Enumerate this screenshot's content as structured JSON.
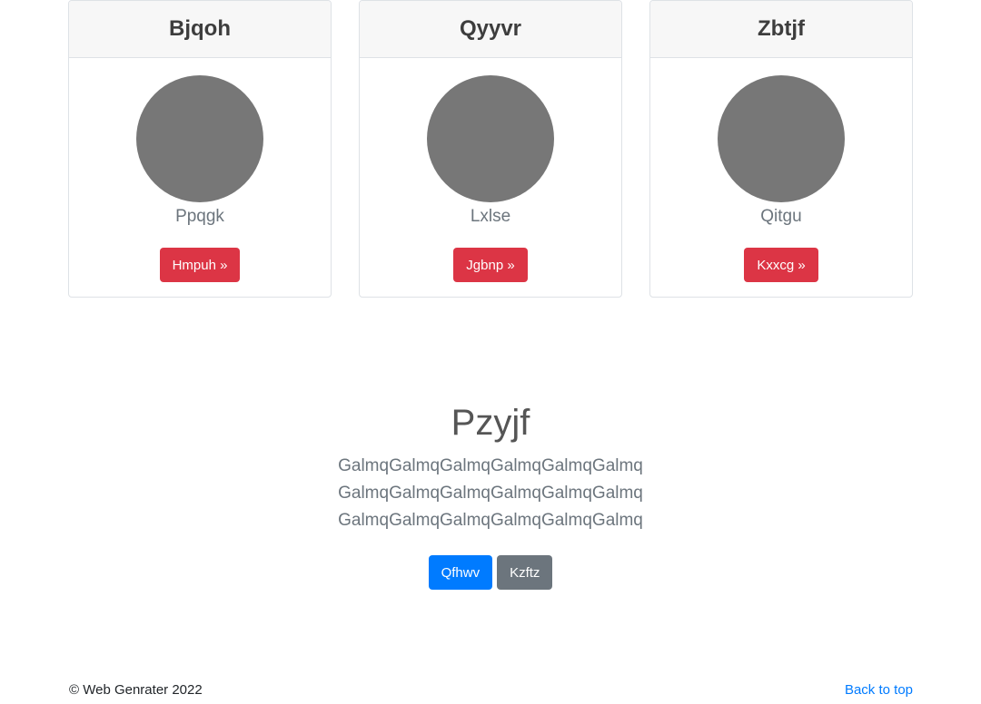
{
  "cards": [
    {
      "title": "Bjqoh",
      "name": "Ppqgk",
      "button": "Hmpuh »"
    },
    {
      "title": "Qyyvr",
      "name": "Lxlse",
      "button": "Jgbnp »"
    },
    {
      "title": "Zbtjf",
      "name": "Qitgu",
      "button": "Kxxcg »"
    }
  ],
  "hero": {
    "title": "Pzyjf",
    "lines": [
      "GalmqGalmqGalmqGalmqGalmqGalmq",
      "GalmqGalmqGalmqGalmqGalmqGalmq",
      "GalmqGalmqGalmqGalmqGalmqGalmq"
    ],
    "primary_button": "Qfhwv",
    "secondary_button": "Kzftz"
  },
  "footer": {
    "copyright": "© Web Genrater 2022",
    "back_to_top": "Back to top"
  },
  "colors": {
    "danger": "#dc3545",
    "primary": "#007bff",
    "secondary": "#6c757d",
    "avatar": "#777777"
  }
}
